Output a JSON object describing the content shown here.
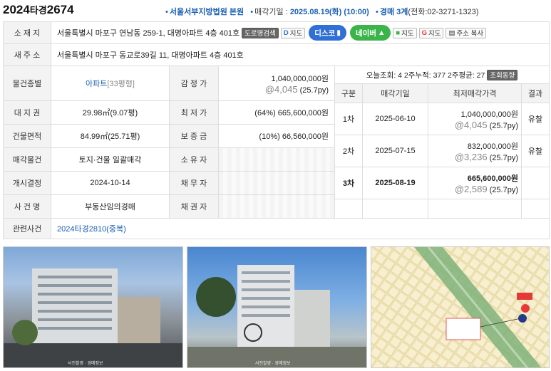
{
  "header": {
    "case_year": "2024",
    "case_type": "타경",
    "case_num": "2674",
    "court": "서울서부지방법원 본원",
    "date_label": "매각기일 : ",
    "date_value": "2025.08.19(화) (10:00)",
    "dept": "경매 3계",
    "phone": "(전화:02-3271-1323)"
  },
  "address": {
    "label": "소 재 지",
    "value": "서울특별시 마포구 연남동 259-1, 대명아파트 4층 401호",
    "road_search": "도로명검색",
    "map_btn": "지도",
    "disco": "디스코",
    "naver": "네이버",
    "map2": "지도",
    "gmap": "지도",
    "copy": "주소 복사"
  },
  "new_address": {
    "label": "새 주 소",
    "value": "서울특별시 마포구 동교로39길 11, 대명아파트 4층 401호"
  },
  "info": {
    "kind_label": "물건종별",
    "kind_value": "아파트",
    "kind_size": "[33평형]",
    "land_label": "대 지 권",
    "land_value": "29.98㎡(9.07평)",
    "bld_label": "건물면적",
    "bld_value": "84.99㎡(25.71평)",
    "sale_label": "매각물건",
    "sale_value": "토지·건물 일괄매각",
    "start_label": "개시결정",
    "start_value": "2024-10-14",
    "case_label": "사 건 명",
    "case_value": "부동산임의경매",
    "appraisal_label": "감 정 가",
    "appraisal_value": "1,040,000,000원",
    "appraisal_unit": "@4,045",
    "appraisal_py": "(25.7py)",
    "min_label": "최 저 가",
    "min_value": "(64%) 665,600,000원",
    "deposit_label": "보 증 금",
    "deposit_value": "(10%) 66,560,000원",
    "owner_label": "소 유 자",
    "debtor_label": "채 무 자",
    "creditor_label": "채 권 자",
    "related_label": "관련사건",
    "related_value": "2024타경2810(중복)"
  },
  "views": {
    "text": "오늘조회: 4  2주누적: 377  2주평균: 27",
    "button": "조회동향"
  },
  "rounds": {
    "headers": [
      "구분",
      "매각기일",
      "최저매각가격",
      "결과"
    ],
    "rows": [
      {
        "no": "1차",
        "date": "2025-06-10",
        "price": "1,040,000,000원",
        "unit": "@4,045",
        "py": "(25.7py)",
        "result": "유찰"
      },
      {
        "no": "2차",
        "date": "2025-07-15",
        "price": "832,000,000원",
        "unit": "@3,236",
        "py": "(25.7py)",
        "result": "유찰"
      },
      {
        "no": "3차",
        "date": "2025-08-19",
        "price": "665,600,000원",
        "unit": "@2,589",
        "py": "(25.7py)",
        "result": ""
      }
    ]
  },
  "photos": {
    "caption": "사진촬영 · 경매정보"
  },
  "colors": {
    "accent": "#1a5fb4",
    "label_bg": "#f3f3f3",
    "disco": "#2f6fd6",
    "naver": "#3bb54a"
  }
}
